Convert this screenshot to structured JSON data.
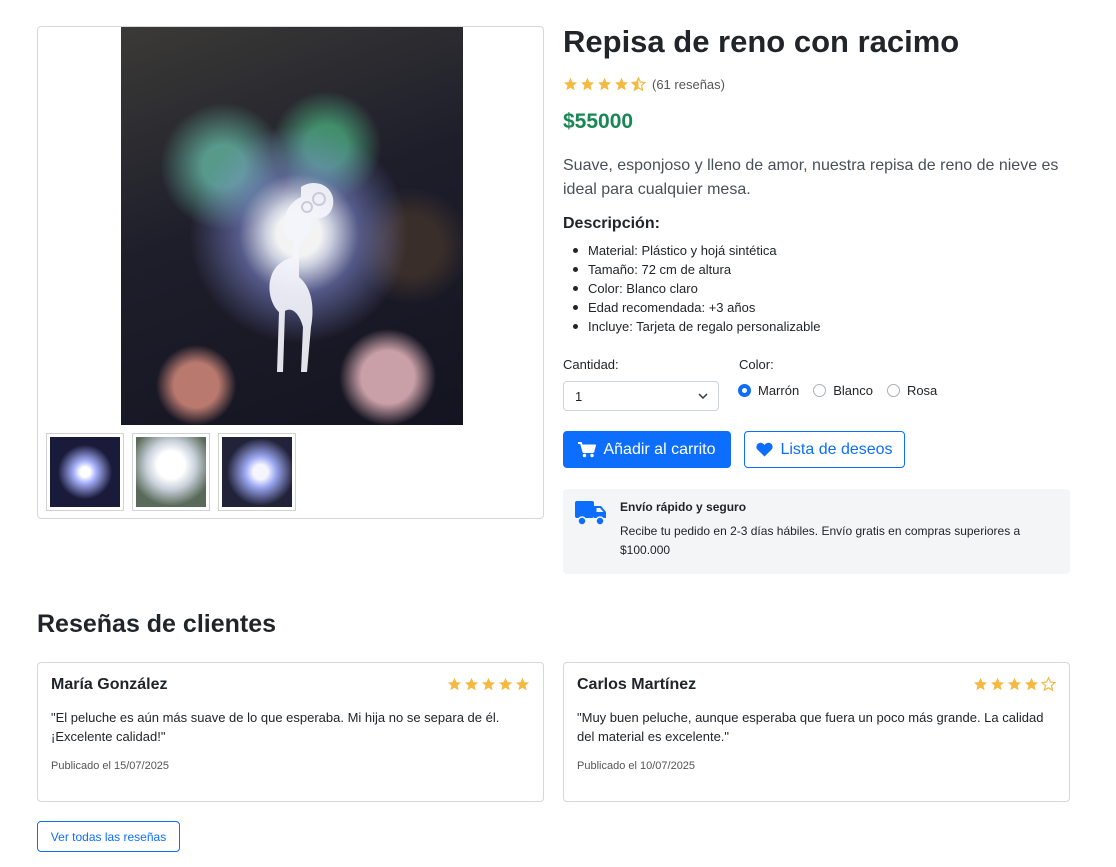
{
  "product": {
    "title": "Repisa de reno con racimo",
    "rating": 4.5,
    "reviews_count": "(61 reseñas)",
    "price": "$55000",
    "description": "Suave, esponjoso y lleno de amor, nuestra repisa de reno de nieve es ideal para cualquier mesa.",
    "description_title": "Descripción:",
    "features": [
      "Material: Plástico y hojá sintética",
      "Tamaño: 72 cm de altura",
      "Color: Blanco claro",
      "Edad recomendada: +3 años",
      "Incluye: Tarjeta de regalo personalizable"
    ]
  },
  "options": {
    "quantity_label": "Cantidad:",
    "quantity_value": "1",
    "color_label": "Color:",
    "colors": [
      "Marrón",
      "Blanco",
      "Rosa"
    ],
    "selected_color": "Marrón"
  },
  "actions": {
    "cart_label": "Añadir al carrito",
    "wishlist_label": "Lista de deseos"
  },
  "shipping": {
    "title": "Envío rápido y seguro",
    "text": "Recibe tu pedido en 2-3 días hábiles. Envío gratis en compras superiores a $100.000"
  },
  "reviews": {
    "title": "Reseñas de clientes",
    "items": [
      {
        "name": "María González",
        "stars": 5,
        "text": "\"El peluche es aún más suave de lo que esperaba. Mi hija no se separa de él. ¡Excelente calidad!\"",
        "date": "Publicado el 15/07/2025"
      },
      {
        "name": "Carlos Martínez",
        "stars": 4,
        "text": "\"Muy buen peluche, aunque esperaba que fuera un poco más grande. La calidad del material es excelente.\"",
        "date": "Publicado el 10/07/2025"
      }
    ],
    "all_label": "Ver todas las reseñas"
  },
  "colors": {
    "primary": "#0d6efd",
    "price": "#198754",
    "star": "#f5b942"
  },
  "icons": [
    "star-icon",
    "cart-icon",
    "heart-icon",
    "truck-icon",
    "chevron-down-icon"
  ]
}
